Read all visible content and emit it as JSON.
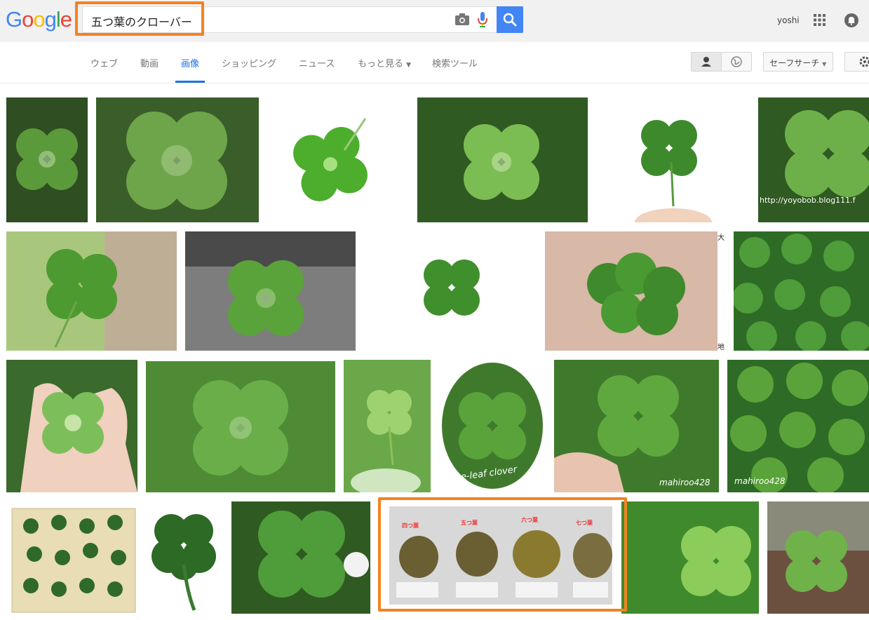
{
  "logo": {
    "text": "Google"
  },
  "search": {
    "query": "五つ葉のクローバー"
  },
  "user": {
    "name": "yoshi"
  },
  "tabs": {
    "web": "ウェブ",
    "video": "動画",
    "images": "画像",
    "shopping": "ショッピング",
    "news": "ニュース",
    "more": "もっと見る",
    "tools": "検索ツール"
  },
  "safesearch": {
    "label": "セーフサーチ"
  },
  "watermarks": {
    "yoyobob": "http://yoyobob.blog111.f",
    "fiveleaf": "Five-leaf clover",
    "mahiroo1": "mahiroo428",
    "mahiroo2": "mahiroo428",
    "kanji_top": "大",
    "kanji_bottom": "地"
  },
  "sheet": {
    "labels": [
      "四つ葉",
      "五つ葉",
      "六つ葉",
      "七つ葉"
    ]
  },
  "colors": {
    "accent": "#1a73e8",
    "highlight": "#f5821f",
    "search_button": "#4285f4"
  }
}
